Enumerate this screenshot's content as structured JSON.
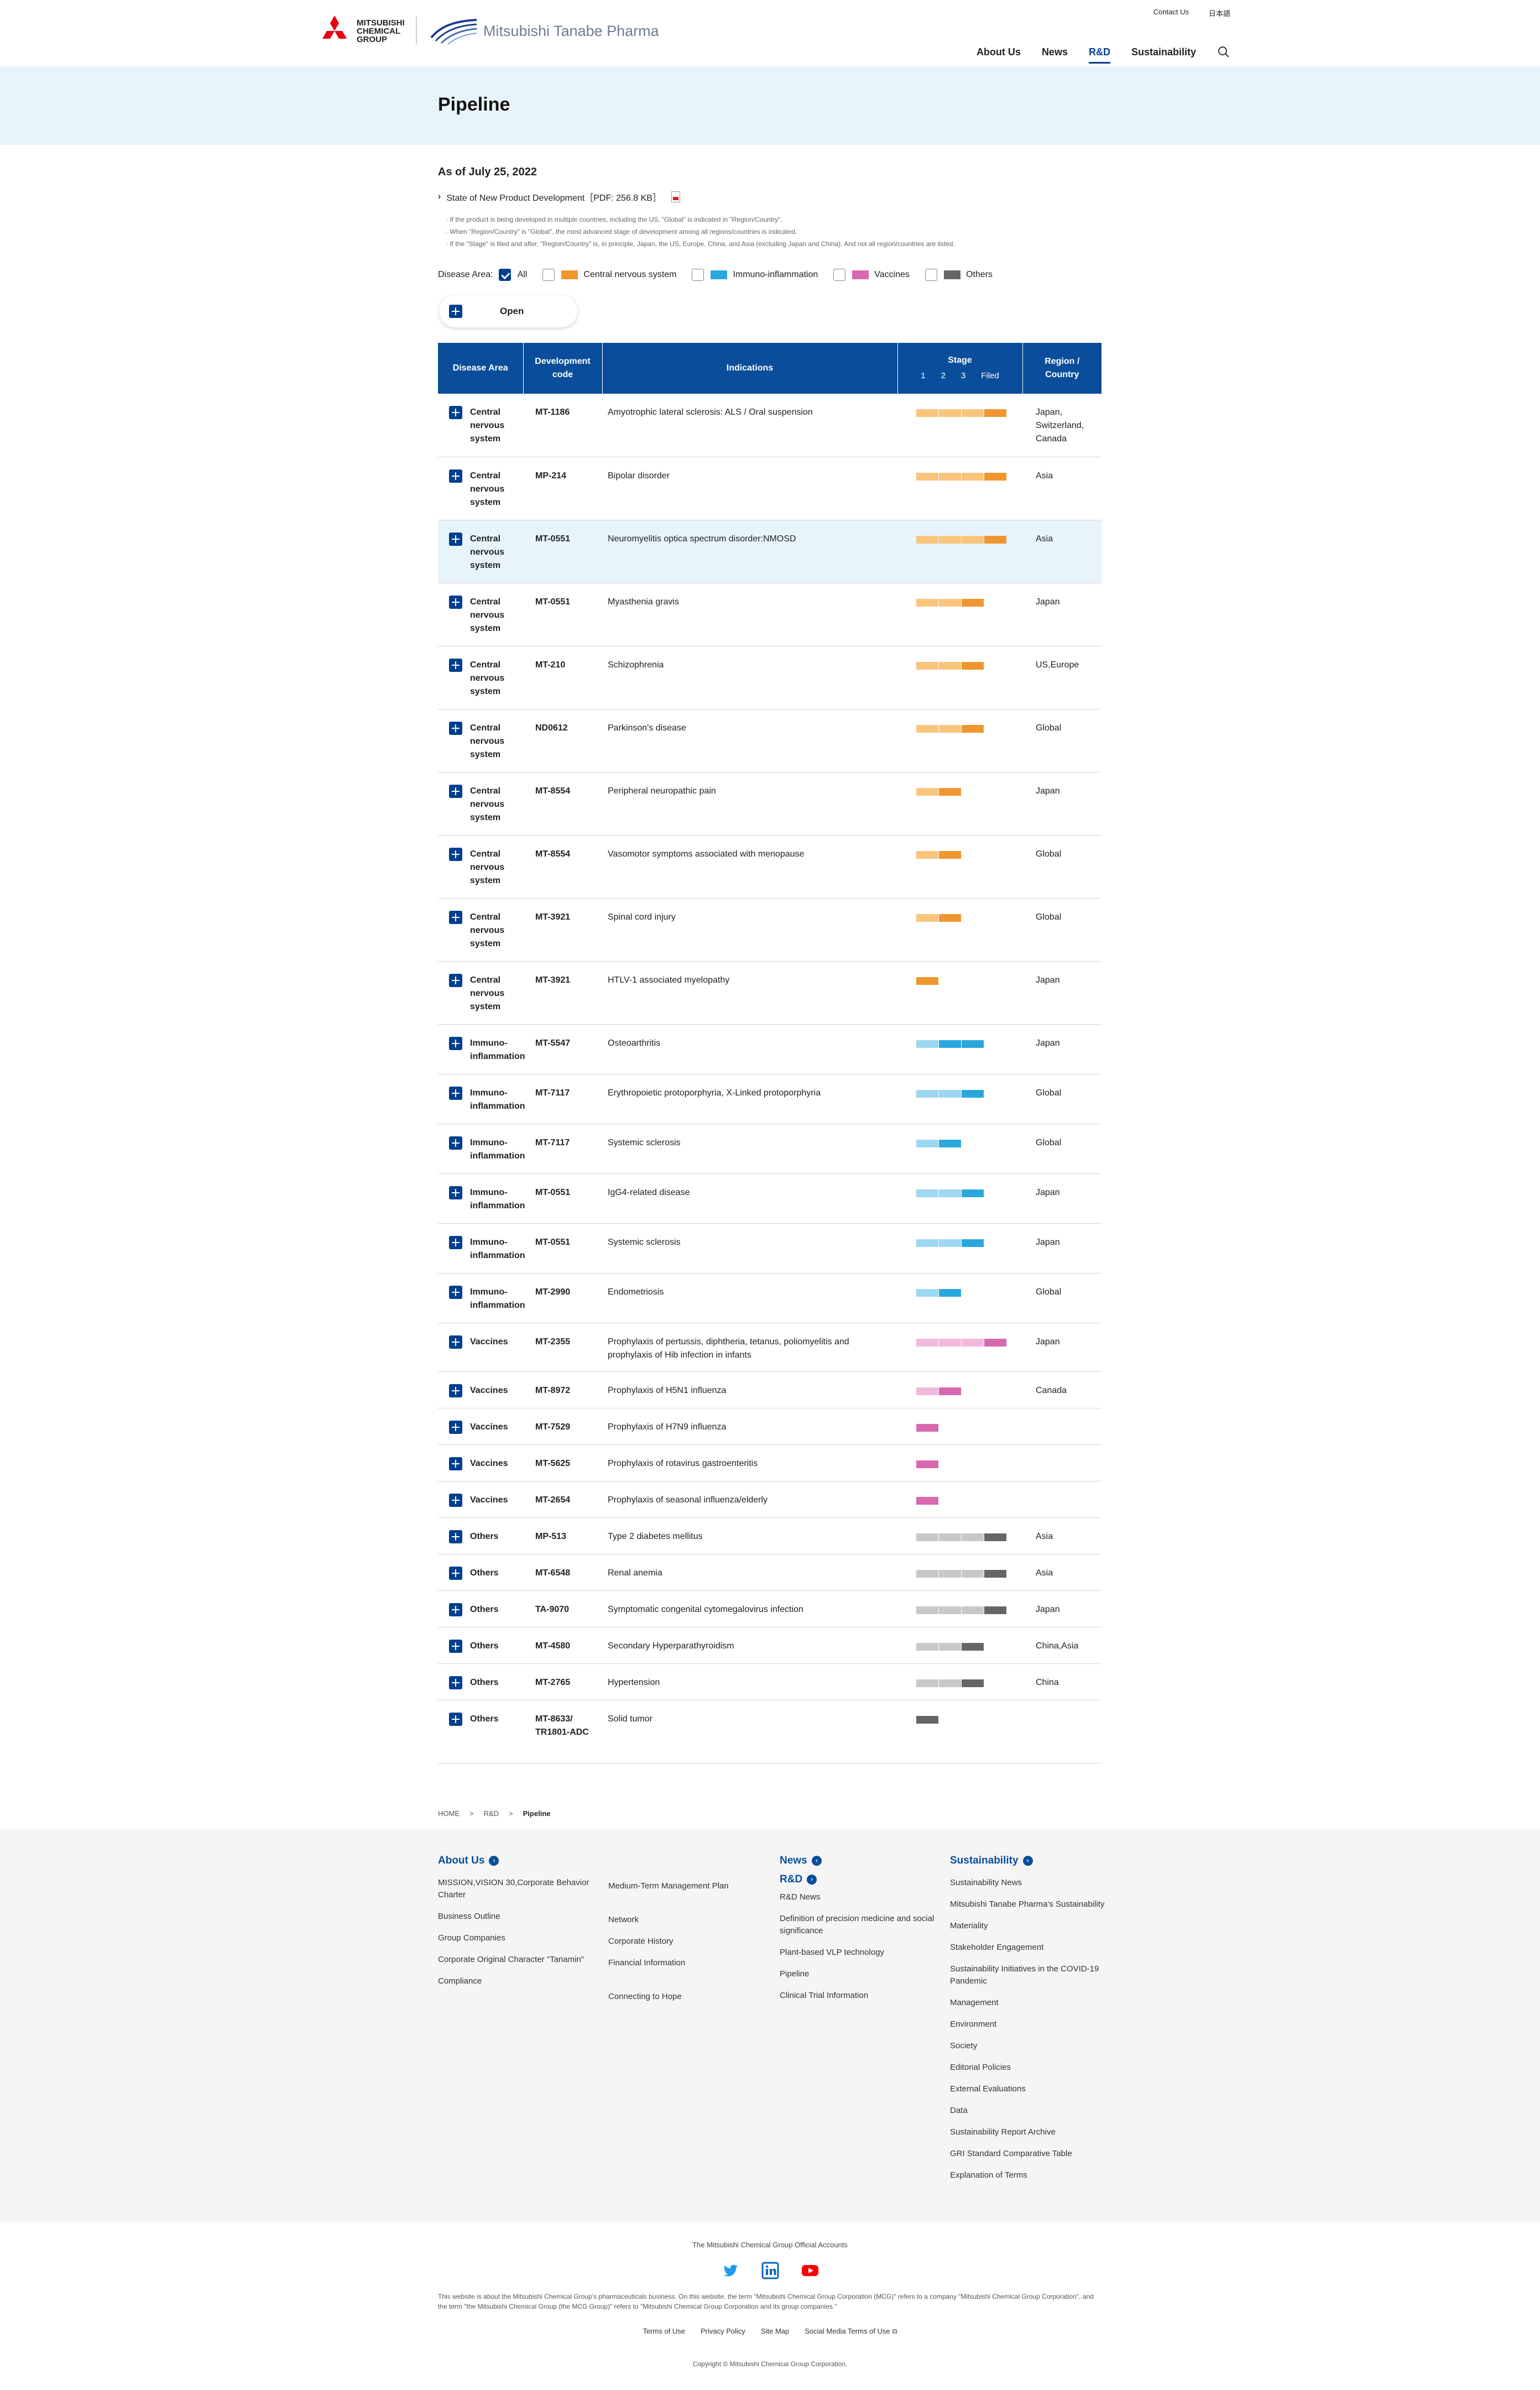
{
  "header": {
    "mcg_logo_text": "MITSUBISHI CHEMICAL GROUP",
    "mtp_logo_text": "Mitsubishi Tanabe Pharma",
    "util": [
      "Contact Us",
      "日本語"
    ],
    "nav": [
      "About Us",
      "News",
      "R&D",
      "Sustainability"
    ],
    "active_nav": "R&D"
  },
  "page_title": "Pipeline",
  "as_of": "As of July 25, 2022",
  "pdf_link": "State of New Product Development［PDF: 256.8 KB］",
  "notes": [
    "If the product is being developed in multiple countries, including the US, \"Global\" is indicated in \"Region/Country\".",
    "When \"Region/Country\" is \"Global\", the most advanced stage of development among all regions/countries is indicated.",
    "If the \"Stage\" is filed and after, \"Region/Country\" is, in principle, Japan, the US, Europe, China, and Asia (excluding Japan and China). And not all region/countries are listed."
  ],
  "filter": {
    "label": "Disease Area:",
    "items": [
      {
        "label": "All",
        "checked": true,
        "color": ""
      },
      {
        "label": "Central nervous system",
        "checked": false,
        "color": "#f0962e"
      },
      {
        "label": "Immuno-inflammation",
        "checked": false,
        "color": "#2aa7dd"
      },
      {
        "label": "Vaccines",
        "checked": false,
        "color": "#d868b0"
      },
      {
        "label": "Others",
        "checked": false,
        "color": "#666666"
      }
    ]
  },
  "open_button": "Open",
  "table": {
    "headers": {
      "area": "Disease Area",
      "code": "Development code",
      "indications": "Indications",
      "stage": "Stage",
      "stage_cols": [
        "1",
        "2",
        "3",
        "Filed"
      ],
      "region": "Region / Country"
    },
    "colors": {
      "cns": [
        "#f9c57d",
        "#f0962e"
      ],
      "imm": [
        "#9dd7f2",
        "#2aa7dd"
      ],
      "vac": [
        "#f0b8dd",
        "#d868b0"
      ],
      "oth": [
        "#c8c8c8",
        "#666666"
      ]
    },
    "rows": [
      {
        "area": "Central nervous system",
        "cat": "cns",
        "code": "MT-1186",
        "ind": "Amyotrophic lateral sclerosis: ALS / Oral suspension",
        "stage": 4,
        "region": "Japan, Switzerland, Canada"
      },
      {
        "area": "Central nervous system",
        "cat": "cns",
        "code": "MP-214",
        "ind": "Bipolar disorder",
        "stage": 4,
        "region": "Asia"
      },
      {
        "area": "Central nervous system",
        "cat": "cns",
        "code": "MT-0551",
        "ind": "Neuromyelitis optica spectrum disorder:NMOSD",
        "stage": 4,
        "region": "Asia",
        "highlight": true
      },
      {
        "area": "Central nervous system",
        "cat": "cns",
        "code": "MT-0551",
        "ind": "Myasthenia gravis",
        "stage": 3,
        "region": "Japan"
      },
      {
        "area": "Central nervous system",
        "cat": "cns",
        "code": "MT-210",
        "ind": "Schizophrenia",
        "stage": 3,
        "region": "US,Europe"
      },
      {
        "area": "Central nervous system",
        "cat": "cns",
        "code": "ND0612",
        "ind": "Parkinson's disease",
        "stage": 3,
        "region": "Global"
      },
      {
        "area": "Central nervous system",
        "cat": "cns",
        "code": "MT-8554",
        "ind": "Peripheral neuropathic pain",
        "stage": 2,
        "region": "Japan"
      },
      {
        "area": "Central nervous system",
        "cat": "cns",
        "code": "MT-8554",
        "ind": "Vasomotor symptoms associated with menopause",
        "stage": 2,
        "region": "Global"
      },
      {
        "area": "Central nervous system",
        "cat": "cns",
        "code": "MT-3921",
        "ind": "Spinal cord injury",
        "stage": 2,
        "region": "Global"
      },
      {
        "area": "Central nervous system",
        "cat": "cns",
        "code": "MT-3921",
        "ind": "HTLV-1 associated myelopathy",
        "stage": 1,
        "region": "Japan"
      },
      {
        "area": "Immuno-inflammation",
        "cat": "imm",
        "code": "MT-5547",
        "ind": "Osteoarthritis",
        "stage": 3,
        "region": "Japan",
        "stage_partial": true
      },
      {
        "area": "Immuno-inflammation",
        "cat": "imm",
        "code": "MT-7117",
        "ind": "Erythropoietic protoporphyria, X-Linked protoporphyria",
        "stage": 3,
        "region": "Global"
      },
      {
        "area": "Immuno-inflammation",
        "cat": "imm",
        "code": "MT-7117",
        "ind": "Systemic sclerosis",
        "stage": 2,
        "region": "Global"
      },
      {
        "area": "Immuno-inflammation",
        "cat": "imm",
        "code": "MT-0551",
        "ind": "IgG4-related disease",
        "stage": 3,
        "region": "Japan"
      },
      {
        "area": "Immuno-inflammation",
        "cat": "imm",
        "code": "MT-0551",
        "ind": "Systemic sclerosis",
        "stage": 3,
        "region": "Japan"
      },
      {
        "area": "Immuno-inflammation",
        "cat": "imm",
        "code": "MT-2990",
        "ind": "Endometriosis",
        "stage": 2,
        "region": "Global"
      },
      {
        "area": "Vaccines",
        "cat": "vac",
        "code": "MT-2355",
        "ind": "Prophylaxis of pertussis, diphtheria, tetanus, poliomyelitis and prophylaxis of Hib infection in infants",
        "stage": 4,
        "region": "Japan"
      },
      {
        "area": "Vaccines",
        "cat": "vac",
        "code": "MT-8972",
        "ind": "Prophylaxis of H5N1 influenza",
        "stage": 2,
        "region": "Canada"
      },
      {
        "area": "Vaccines",
        "cat": "vac",
        "code": "MT-7529",
        "ind": "Prophylaxis of H7N9 influenza",
        "stage": 1,
        "region": ""
      },
      {
        "area": "Vaccines",
        "cat": "vac",
        "code": "MT-5625",
        "ind": "Prophylaxis of rotavirus gastroenteritis",
        "stage": 1,
        "region": ""
      },
      {
        "area": "Vaccines",
        "cat": "vac",
        "code": "MT-2654",
        "ind": "Prophylaxis of seasonal influenza/elderly",
        "stage": 1,
        "region": ""
      },
      {
        "area": "Others",
        "cat": "oth",
        "code": "MP-513",
        "ind": "Type 2 diabetes mellitus",
        "stage": 4,
        "region": "Asia"
      },
      {
        "area": "Others",
        "cat": "oth",
        "code": "MT-6548",
        "ind": "Renal anemia",
        "stage": 4,
        "region": "Asia"
      },
      {
        "area": "Others",
        "cat": "oth",
        "code": "TA-9070",
        "ind": "Symptomatic congenital cytomegalovirus infection",
        "stage": 4,
        "region": "Japan"
      },
      {
        "area": "Others",
        "cat": "oth",
        "code": "MT-4580",
        "ind": "Secondary Hyperparathyroidism",
        "stage": 3,
        "region": "China,Asia"
      },
      {
        "area": "Others",
        "cat": "oth",
        "code": "MT-2765",
        "ind": "Hypertension",
        "stage": 3,
        "region": "China"
      },
      {
        "area": "Others",
        "cat": "oth",
        "code": "MT-8633/ TR1801-ADC",
        "ind": "Solid tumor",
        "stage": 1,
        "region": ""
      }
    ]
  },
  "breadcrumb": [
    "HOME",
    "R&D",
    "Pipeline"
  ],
  "footer": {
    "about": {
      "title": "About Us",
      "items": [
        "MISSION,VISION 30,Corporate Behavior Charter",
        "Business Outline",
        "Group Companies",
        "Corporate Original Character \"Tanamin\"",
        "Compliance"
      ]
    },
    "about2": {
      "items": [
        "Medium-Term Management Plan",
        "Network",
        "Corporate History",
        "Financial Information",
        "Connecting to Hope"
      ]
    },
    "news": {
      "title": "News"
    },
    "rd": {
      "title": "R&D",
      "items": [
        "R&D News",
        "Definition of precision medicine and social significance",
        "Plant-based VLP technology",
        "Pipeline",
        "Clinical Trial Information"
      ]
    },
    "sustainability": {
      "title": "Sustainability",
      "items": [
        "Sustainability News",
        "Mitsubishi Tanabe Pharma's Sustainability",
        "Materiality",
        "Stakeholder Engagement",
        "Sustainability Initiatives in the COVID-19 Pandemic",
        "Management",
        "Environment",
        "Society",
        "Editorial Policies",
        "External Evaluations",
        "Data",
        "Sustainability Report Archive",
        "GRI Standard Comparative Table",
        "Explanation of Terms"
      ]
    }
  },
  "bottom": {
    "social_title": "The Mitsubishi Chemical Group Official Accounts",
    "social_icons": [
      "twitter-icon",
      "linkedin-icon",
      "youtube-icon"
    ],
    "disclaimer": "This website is about the Mitsubishi Chemical Group's pharmaceuticals business. On this website, the term \"Mitsubishi Chemical Group Corporation (MCG)\" refers to a company \"Mitsubishi Chemical Group Corporation\", and the term \"the Mitsubishi Chemical Group (the MCG Group)\" refers to \"Mitsubishi Chemical Group Corporation and its group companies.\"",
    "links": [
      "Terms of Use",
      "Privacy Policy",
      "Site Map",
      "Social Media Terms of Use"
    ],
    "copyright": "Copyright © Mitsubishi Chemical Group Corporation."
  }
}
